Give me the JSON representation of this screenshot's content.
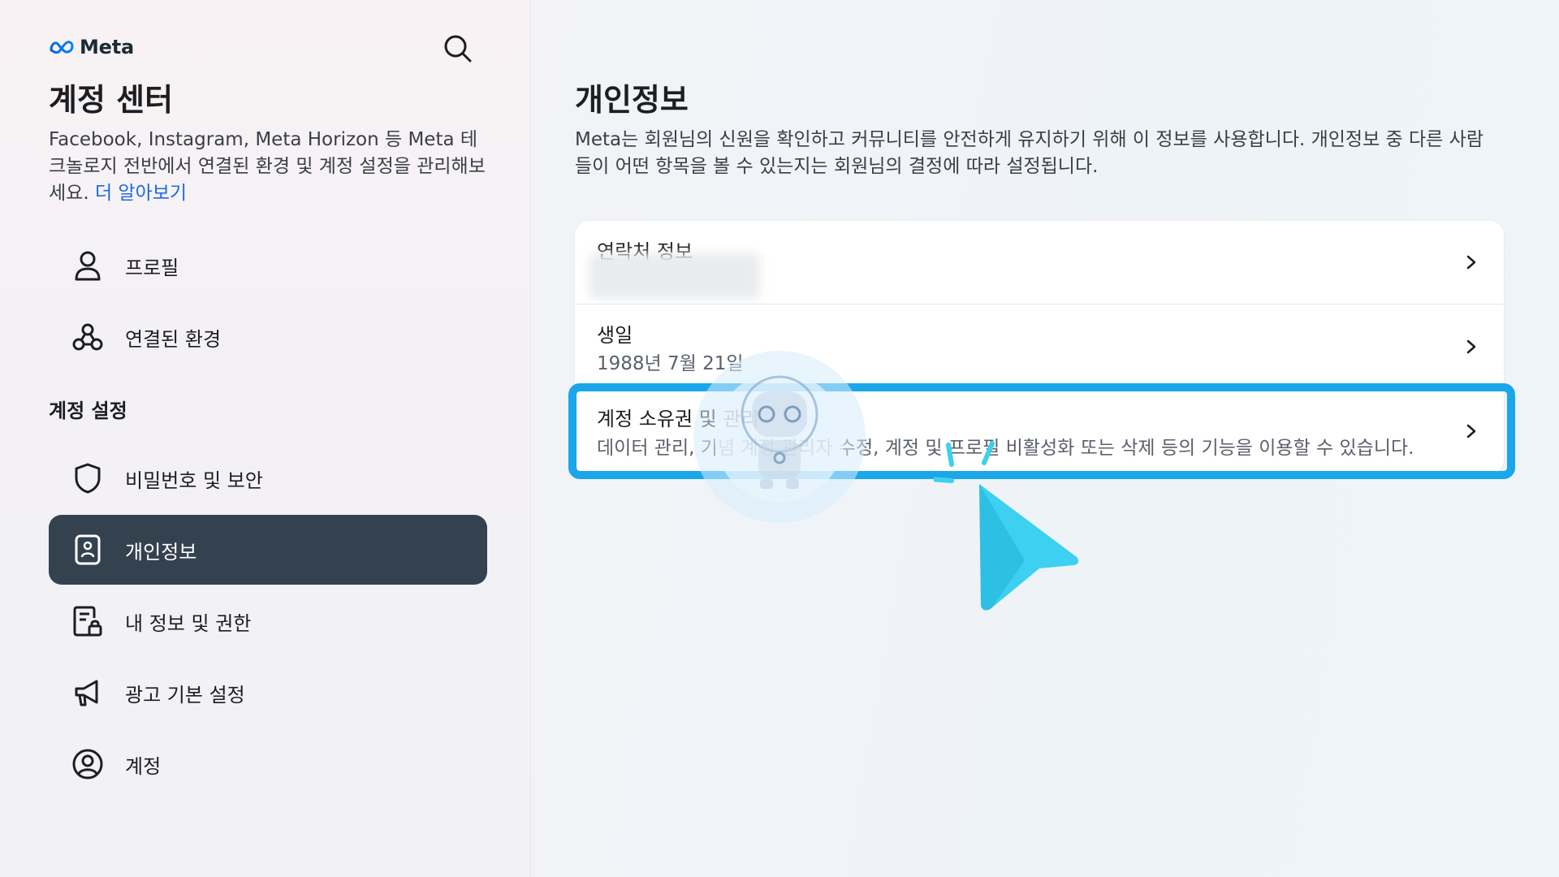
{
  "brand": {
    "name": "Meta"
  },
  "sidebar": {
    "title": "계정 센터",
    "description": "Facebook, Instagram, Meta Horizon 등 Meta 테크놀로지 전반에서 연결된 환경 및 계정 설정을 관리해보세요.",
    "learn_more": "더 알아보기",
    "items": [
      {
        "label": "프로필",
        "icon": "person-icon"
      },
      {
        "label": "연결된 환경",
        "icon": "connected-experiences-icon"
      }
    ],
    "section_title": "계정 설정",
    "settings_items": [
      {
        "label": "비밀번호 및 보안",
        "icon": "shield-icon"
      },
      {
        "label": "개인정보",
        "icon": "id-card-icon",
        "active": true
      },
      {
        "label": "내 정보 및 권한",
        "icon": "document-lock-icon"
      },
      {
        "label": "광고 기본 설정",
        "icon": "megaphone-icon"
      },
      {
        "label": "계정",
        "icon": "account-circle-icon"
      }
    ]
  },
  "main": {
    "title": "개인정보",
    "description": "Meta는 회원님의 신원을 확인하고 커뮤니티를 안전하게 유지하기 위해 이 정보를 사용합니다. 개인정보 중 다른 사람들이 어떤 항목을 볼 수 있는지는 회원님의 결정에 따라 설정됩니다.",
    "rows": [
      {
        "title": "연락처 정보",
        "value": ""
      },
      {
        "title": "생일",
        "value": "1988년 7월 21일"
      },
      {
        "title": "계정 소유권 및 관리",
        "value": "데이터 관리, 기념 계정 관리자 수정, 계정 및 프로필 비활성화 또는 삭제 등의 기능을 이용할 수 있습니다."
      }
    ]
  },
  "colors": {
    "active_nav": "#344250",
    "link": "#1b6ae0",
    "highlight": "#1ba6ea",
    "cursor": "#3dd0f0"
  }
}
